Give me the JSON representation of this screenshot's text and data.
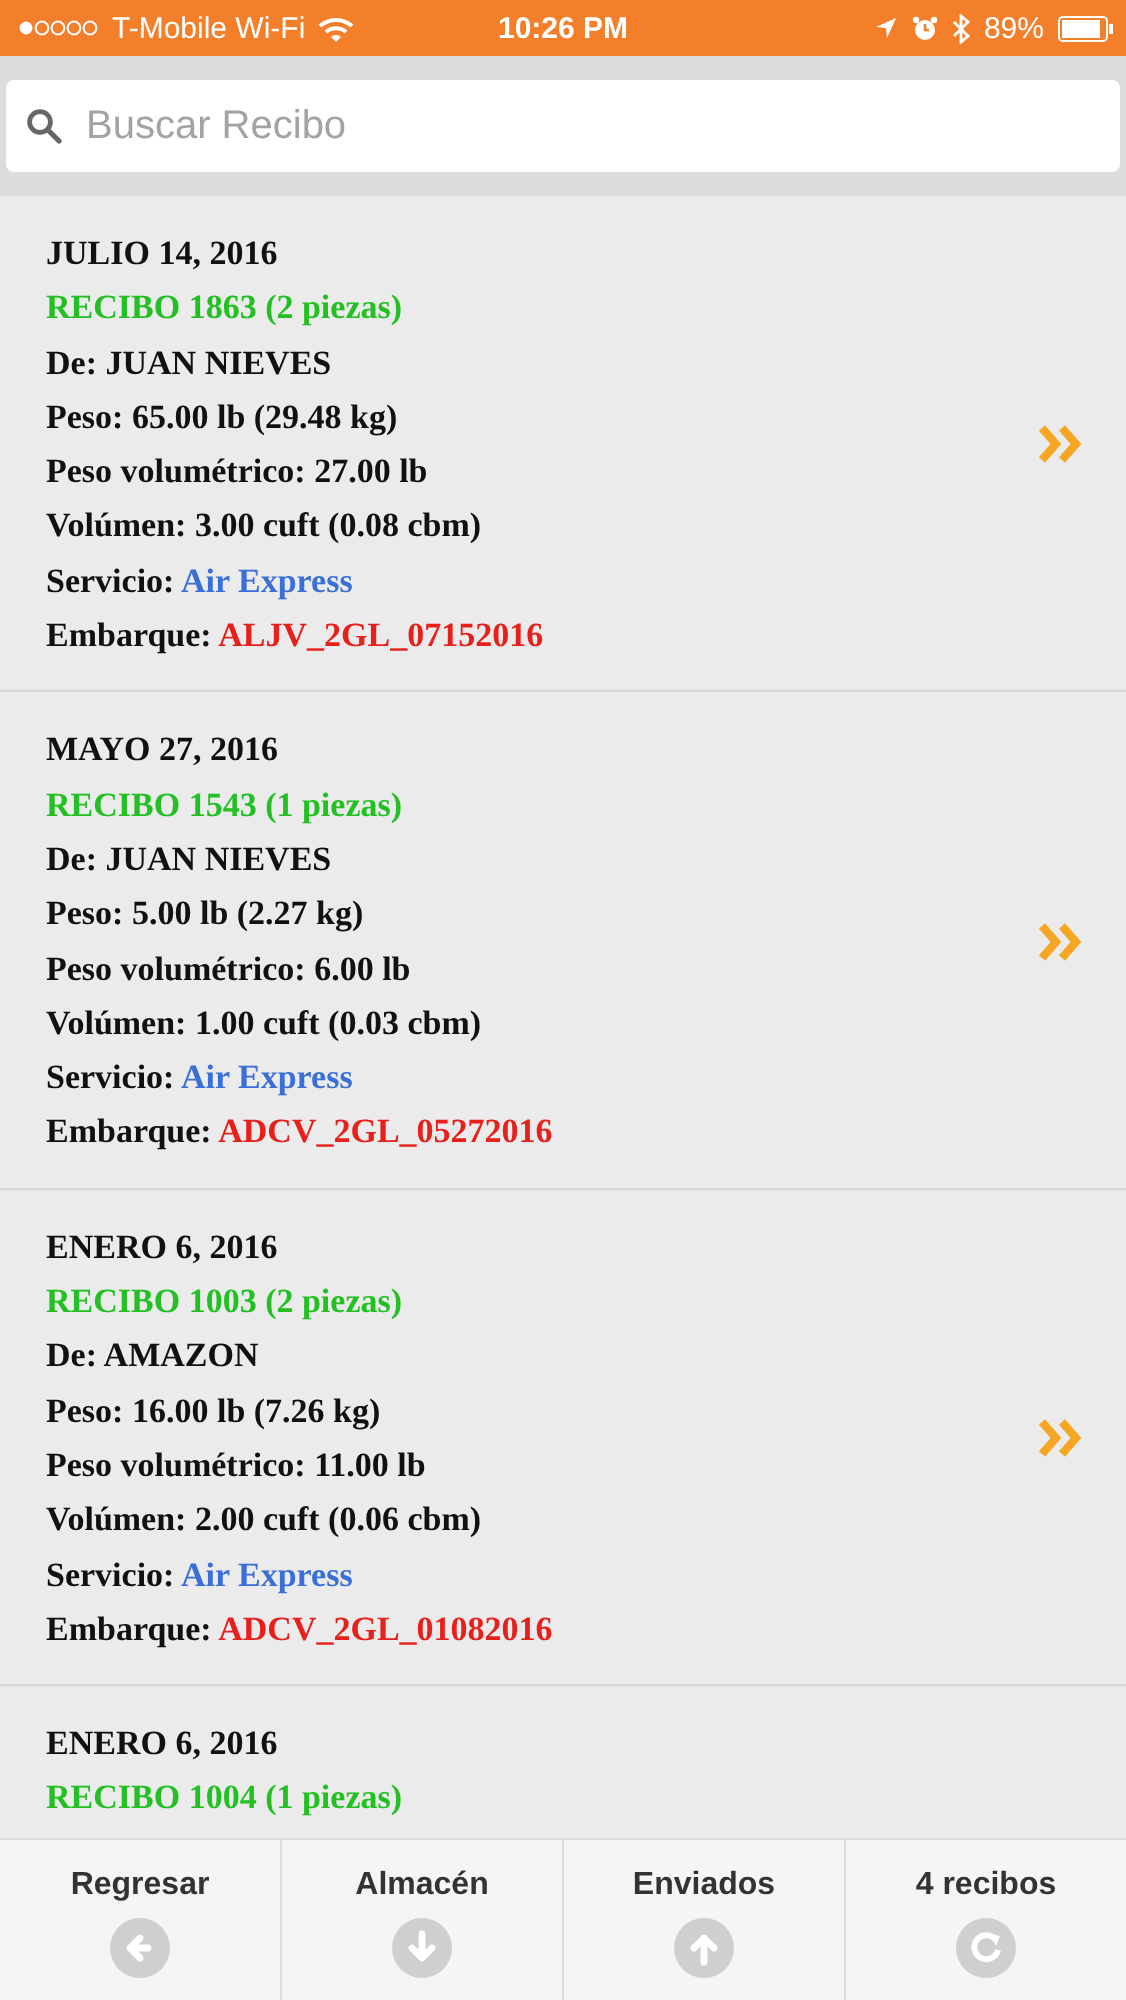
{
  "status_bar": {
    "carrier": "T-Mobile Wi-Fi",
    "time": "10:26 PM",
    "battery": "89%"
  },
  "search": {
    "placeholder": "Buscar Recibo"
  },
  "receipts": [
    {
      "date": "JULIO 14, 2016",
      "receipt": "RECIBO 1863 (2 piezas)",
      "fields": [
        {
          "label": "De:",
          "value": "JUAN NIEVES",
          "kind": "plain"
        },
        {
          "label": "Peso:",
          "value": "65.00 lb (29.48 kg)",
          "kind": "plain"
        },
        {
          "label": "Peso volumétrico:",
          "value": "27.00 lb",
          "kind": "plain"
        },
        {
          "label": "Volúmen:",
          "value": "3.00 cuft (0.08 cbm)",
          "kind": "plain"
        },
        {
          "label": "Servicio:",
          "value": "Air Express",
          "kind": "service"
        },
        {
          "label": "Embarque:",
          "value": "ALJV_2GL_07152016",
          "kind": "shipment"
        }
      ]
    },
    {
      "date": "MAYO 27, 2016",
      "receipt": "RECIBO 1543 (1 piezas)",
      "fields": [
        {
          "label": "De:",
          "value": "JUAN NIEVES",
          "kind": "plain"
        },
        {
          "label": "Peso:",
          "value": "5.00 lb (2.27 kg)",
          "kind": "plain"
        },
        {
          "label": "Peso volumétrico:",
          "value": "6.00 lb",
          "kind": "plain"
        },
        {
          "label": "Volúmen:",
          "value": "1.00 cuft (0.03 cbm)",
          "kind": "plain"
        },
        {
          "label": "Servicio:",
          "value": "Air Express",
          "kind": "service"
        },
        {
          "label": "Embarque:",
          "value": "ADCV_2GL_05272016",
          "kind": "shipment"
        }
      ]
    },
    {
      "date": "ENERO 6, 2016",
      "receipt": "RECIBO 1003 (2 piezas)",
      "fields": [
        {
          "label": "De:",
          "value": "AMAZON",
          "kind": "plain"
        },
        {
          "label": "Peso:",
          "value": "16.00 lb (7.26 kg)",
          "kind": "plain"
        },
        {
          "label": "Peso volumétrico:",
          "value": "11.00 lb",
          "kind": "plain"
        },
        {
          "label": "Volúmen:",
          "value": "2.00 cuft (0.06 cbm)",
          "kind": "plain"
        },
        {
          "label": "Servicio:",
          "value": "Air Express",
          "kind": "service"
        },
        {
          "label": "Embarque:",
          "value": "ADCV_2GL_01082016",
          "kind": "shipment"
        }
      ]
    },
    {
      "date": "ENERO 6, 2016",
      "receipt": "RECIBO 1004 (1 piezas)"
    }
  ],
  "tab_bar": [
    {
      "label": "Regresar",
      "kind": "back"
    },
    {
      "label": "Almacén",
      "kind": "down"
    },
    {
      "label": "Enviados",
      "kind": "up"
    },
    {
      "label": "4 recibos",
      "kind": "refresh"
    }
  ]
}
